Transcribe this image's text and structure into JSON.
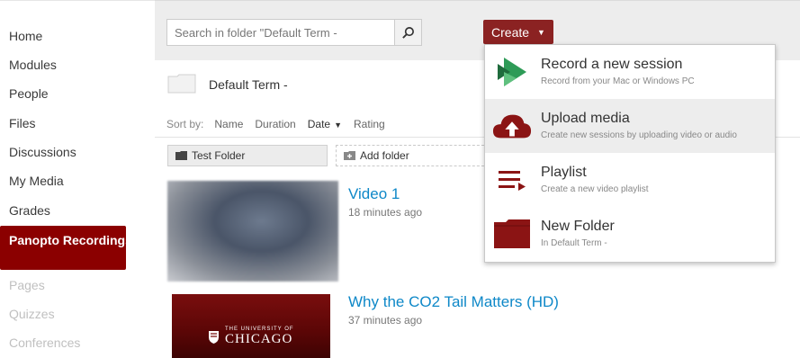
{
  "nav": {
    "items": [
      {
        "label": "Home",
        "state": "normal"
      },
      {
        "label": "Modules",
        "state": "normal"
      },
      {
        "label": "People",
        "state": "normal"
      },
      {
        "label": "Files",
        "state": "normal"
      },
      {
        "label": "Discussions",
        "state": "normal"
      },
      {
        "label": "My Media",
        "state": "normal"
      },
      {
        "label": "Grades",
        "state": "normal"
      },
      {
        "label": "Panopto Recordings",
        "state": "active"
      },
      {
        "label": "Pages",
        "state": "disabled"
      },
      {
        "label": "Quizzes",
        "state": "disabled"
      },
      {
        "label": "Conferences",
        "state": "disabled"
      }
    ]
  },
  "toolbar": {
    "search_placeholder": "Search in folder \"Default Term -",
    "create_label": "Create"
  },
  "folder": {
    "name": "Default Term -"
  },
  "sort": {
    "label": "Sort by:",
    "options": [
      "Name",
      "Duration",
      "Date",
      "Rating"
    ],
    "active": "Date"
  },
  "folders": {
    "test_folder": "Test Folder",
    "add_folder": "Add folder"
  },
  "sessions": [
    {
      "title": "Video 1",
      "time": "18 minutes ago"
    },
    {
      "title": "Why the CO2 Tail Matters (HD)",
      "time": "37 minutes ago"
    }
  ],
  "thumbnail_text": {
    "line1": "THE UNIVERSITY OF",
    "line2": "CHICAGO"
  },
  "create_menu": [
    {
      "title": "Record a new session",
      "subtitle": "Record from your Mac or Windows PC",
      "icon": "panopto-record-icon"
    },
    {
      "title": "Upload media",
      "subtitle": "Create new sessions by uploading video or audio",
      "icon": "cloud-upload-icon"
    },
    {
      "title": "Playlist",
      "subtitle": "Create a new video playlist",
      "icon": "playlist-icon"
    },
    {
      "title": "New Folder",
      "subtitle": "In Default Term -",
      "icon": "folder-icon"
    }
  ],
  "colors": {
    "accent": "#8b2222",
    "nav_active": "#8b0000",
    "link": "#0e88c8"
  }
}
